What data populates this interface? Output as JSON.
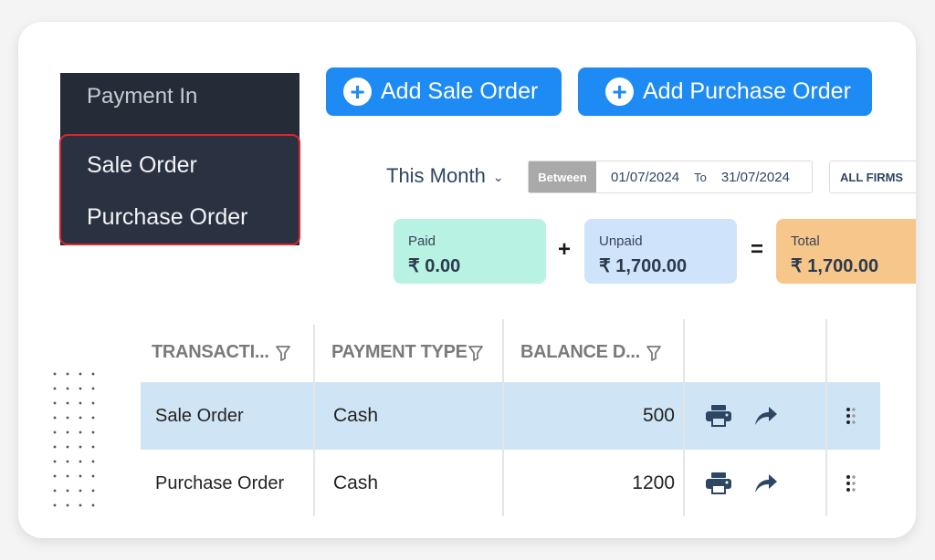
{
  "menu": {
    "title": "Payment In",
    "items": [
      {
        "label": "Sale Order"
      },
      {
        "label": "Purchase Order"
      }
    ],
    "highlight_color": "#e0222f"
  },
  "actions": {
    "add_sale_order": "Add Sale Order",
    "add_purchase_order": "Add Purchase Order",
    "add_icon": "plus-circle-icon"
  },
  "filters": {
    "period": "This Month",
    "between_label": "Between",
    "from_date": "01/07/2024",
    "to_label": "To",
    "to_date": "31/07/2024",
    "firm": "ALL FIRMS"
  },
  "summary": {
    "paid": {
      "label": "Paid",
      "value": "₹ 0.00",
      "color": "#b8f2e3"
    },
    "plus": "+",
    "unpaid": {
      "label": "Unpaid",
      "value": "₹ 1,700.00",
      "color": "#cfe3fb"
    },
    "equals": "=",
    "total": {
      "label": "Total",
      "value": "₹ 1,700.00",
      "color": "#f7c68a"
    }
  },
  "table": {
    "columns": [
      {
        "label": "TRANSACTI..."
      },
      {
        "label": "PAYMENT TYPE"
      },
      {
        "label": "BALANCE D..."
      }
    ],
    "rows": [
      {
        "transaction": "Sale Order",
        "payment_type": "Cash",
        "balance": "500",
        "selected": true
      },
      {
        "transaction": "Purchase Order",
        "payment_type": "Cash",
        "balance": "1200",
        "selected": false
      }
    ],
    "row_actions": [
      "print-icon",
      "share-icon",
      "more-options-icon"
    ]
  },
  "colors": {
    "accent": "#1e8af4",
    "menu_bg": "#252b37",
    "selected_row": "#cfe5f5",
    "heading_text": "#2d4663"
  }
}
